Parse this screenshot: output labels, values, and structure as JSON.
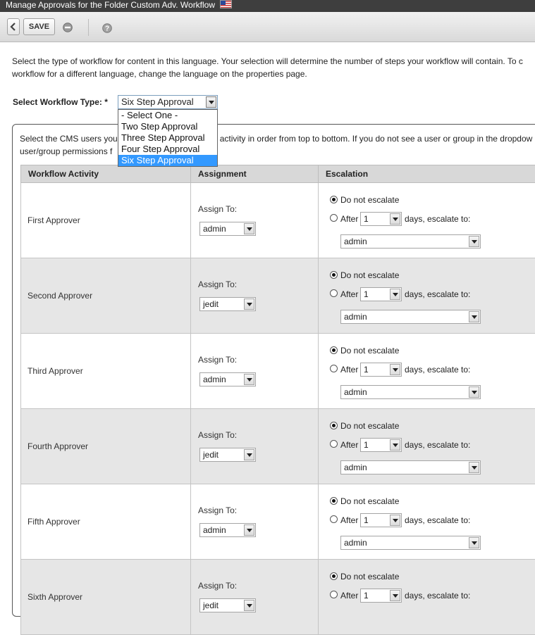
{
  "window": {
    "title": "Manage Approvals for the Folder Custom Adv. Workflow"
  },
  "toolbar": {
    "save_label": "SAVE"
  },
  "intro": {
    "line1": "Select the type of workflow for content in this language. Your selection will determine the number of steps your workflow will contain. To c",
    "line2": "workflow for a different language, change the language on the properties page."
  },
  "workflow_type": {
    "label": "Select Workflow Type: *",
    "selected": "Six Step Approval",
    "options": [
      "- Select One -",
      "Two Step Approval",
      "Three Step Approval",
      "Four Step Approval",
      "Six Step Approval"
    ]
  },
  "panel": {
    "line1_a": "Select the CMS users you",
    "line1_b": "activity in order from top to bottom. If you do not see a user or group in the dropdow",
    "line2": "user/group permissions f"
  },
  "table": {
    "headers": [
      "Workflow Activity",
      "Assignment",
      "Escalation"
    ],
    "assign_label": "Assign To:",
    "no_escalate": "Do not escalate",
    "after": "After",
    "days_escalate": "days, escalate to:",
    "rows": [
      {
        "activity": "First Approver",
        "assignee": "admin",
        "days": "1",
        "escalate_to": "admin"
      },
      {
        "activity": "Second Approver",
        "assignee": "jedit",
        "days": "1",
        "escalate_to": "admin"
      },
      {
        "activity": "Third Approver",
        "assignee": "admin",
        "days": "1",
        "escalate_to": "admin"
      },
      {
        "activity": "Fourth Approver",
        "assignee": "jedit",
        "days": "1",
        "escalate_to": "admin"
      },
      {
        "activity": "Fifth Approver",
        "assignee": "admin",
        "days": "1",
        "escalate_to": "admin"
      },
      {
        "activity": "Sixth Approver",
        "assignee": "jedit",
        "days": "1",
        "escalate_to": ""
      }
    ]
  }
}
